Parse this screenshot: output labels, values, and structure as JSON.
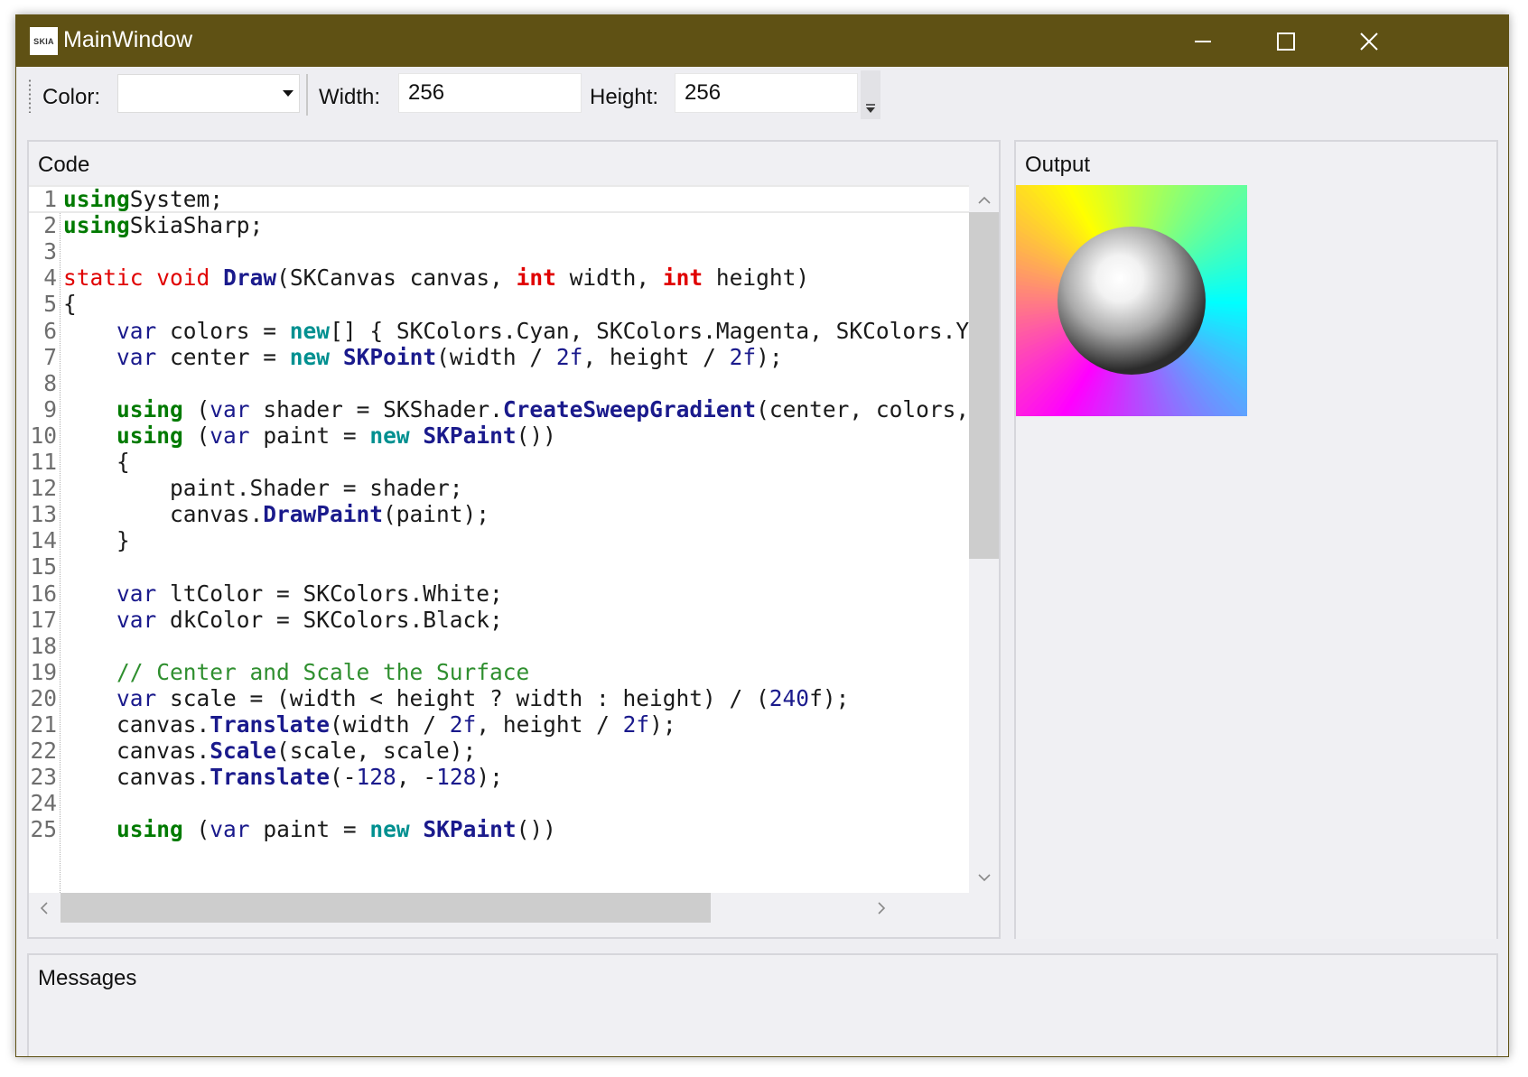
{
  "window": {
    "title": "MainWindow",
    "icon_text": "SKIA",
    "colors": {
      "titlebar": "#5f5114",
      "accent_text": "#ffffff"
    },
    "controls": [
      "minimize-icon",
      "maximize-icon",
      "close-icon"
    ]
  },
  "toolbar": {
    "color_label": "Color:",
    "color_value": "",
    "width_label": "Width:",
    "width_value": "256",
    "height_label": "Height:",
    "height_value": "256"
  },
  "code_panel": {
    "header": "Code",
    "lines": [
      {
        "n": "1",
        "tokens": [
          [
            "k-using",
            "using"
          ],
          [
            "",
            "System;"
          ]
        ]
      },
      {
        "n": "2",
        "tokens": [
          [
            "k-using",
            "using"
          ],
          [
            "",
            "SkiaSharp;"
          ]
        ]
      },
      {
        "n": "3",
        "tokens": []
      },
      {
        "n": "4",
        "tokens": [
          [
            "k-red",
            "static"
          ],
          [
            "",
            " "
          ],
          [
            "k-red",
            "void"
          ],
          [
            "",
            " "
          ],
          [
            "k-method",
            "Draw"
          ],
          [
            "",
            "(SKCanvas canvas, "
          ],
          [
            "k-red-bold",
            "int"
          ],
          [
            "",
            " width, "
          ],
          [
            "k-red-bold",
            "int"
          ],
          [
            "",
            " height)"
          ]
        ]
      },
      {
        "n": "5",
        "tokens": [
          [
            "",
            "{"
          ]
        ]
      },
      {
        "n": "6",
        "tokens": [
          [
            "",
            "    "
          ],
          [
            "k-var",
            "var"
          ],
          [
            "",
            " colors = "
          ],
          [
            "k-new",
            "new"
          ],
          [
            "",
            "[] { SKColors.Cyan, SKColors.Magenta, SKColors.Y"
          ]
        ]
      },
      {
        "n": "7",
        "tokens": [
          [
            "",
            "    "
          ],
          [
            "k-var",
            "var"
          ],
          [
            "",
            " center = "
          ],
          [
            "k-new",
            "new"
          ],
          [
            "",
            " "
          ],
          [
            "k-method",
            "SKPoint"
          ],
          [
            "",
            "(width / "
          ],
          [
            "k-num",
            "2f"
          ],
          [
            "",
            ", height / "
          ],
          [
            "k-num",
            "2f"
          ],
          [
            "",
            ");"
          ]
        ]
      },
      {
        "n": "8",
        "tokens": []
      },
      {
        "n": "9",
        "tokens": [
          [
            "",
            "    "
          ],
          [
            "k-using",
            "using"
          ],
          [
            "",
            " ("
          ],
          [
            "k-var",
            "var"
          ],
          [
            "",
            " shader = SKShader."
          ],
          [
            "k-method",
            "CreateSweepGradient"
          ],
          [
            "",
            "(center, colors,"
          ]
        ]
      },
      {
        "n": "10",
        "tokens": [
          [
            "",
            "    "
          ],
          [
            "k-using",
            "using"
          ],
          [
            "",
            " ("
          ],
          [
            "k-var",
            "var"
          ],
          [
            "",
            " paint = "
          ],
          [
            "k-new",
            "new"
          ],
          [
            "",
            " "
          ],
          [
            "k-method",
            "SKPaint"
          ],
          [
            "",
            "())"
          ]
        ]
      },
      {
        "n": "11",
        "tokens": [
          [
            "",
            "    {"
          ]
        ]
      },
      {
        "n": "12",
        "tokens": [
          [
            "",
            "        paint.Shader = shader;"
          ]
        ]
      },
      {
        "n": "13",
        "tokens": [
          [
            "",
            "        canvas."
          ],
          [
            "k-method",
            "DrawPaint"
          ],
          [
            "",
            "(paint);"
          ]
        ]
      },
      {
        "n": "14",
        "tokens": [
          [
            "",
            "    }"
          ]
        ]
      },
      {
        "n": "15",
        "tokens": []
      },
      {
        "n": "16",
        "tokens": [
          [
            "",
            "    "
          ],
          [
            "k-var",
            "var"
          ],
          [
            "",
            " ltColor = SKColors.White;"
          ]
        ]
      },
      {
        "n": "17",
        "tokens": [
          [
            "",
            "    "
          ],
          [
            "k-var",
            "var"
          ],
          [
            "",
            " dkColor = SKColors.Black;"
          ]
        ]
      },
      {
        "n": "18",
        "tokens": []
      },
      {
        "n": "19",
        "tokens": [
          [
            "",
            "    "
          ],
          [
            "k-comment",
            "// Center and Scale the Surface"
          ]
        ]
      },
      {
        "n": "20",
        "tokens": [
          [
            "",
            "    "
          ],
          [
            "k-var",
            "var"
          ],
          [
            "",
            " scale = (width < height ? width : height) / ("
          ],
          [
            "k-num",
            "240"
          ],
          [
            "",
            "f);"
          ]
        ]
      },
      {
        "n": "21",
        "tokens": [
          [
            "",
            "    canvas."
          ],
          [
            "k-method",
            "Translate"
          ],
          [
            "",
            "(width / "
          ],
          [
            "k-num",
            "2f"
          ],
          [
            "",
            ", height / "
          ],
          [
            "k-num",
            "2f"
          ],
          [
            "",
            ");"
          ]
        ]
      },
      {
        "n": "22",
        "tokens": [
          [
            "",
            "    canvas."
          ],
          [
            "k-method",
            "Scale"
          ],
          [
            "",
            "(scale, scale);"
          ]
        ]
      },
      {
        "n": "23",
        "tokens": [
          [
            "",
            "    canvas."
          ],
          [
            "k-method",
            "Translate"
          ],
          [
            "",
            "(-"
          ],
          [
            "k-num",
            "128"
          ],
          [
            "",
            ", -"
          ],
          [
            "k-num",
            "128"
          ],
          [
            "",
            ");"
          ]
        ]
      },
      {
        "n": "24",
        "tokens": []
      },
      {
        "n": "25",
        "tokens": [
          [
            "",
            "    "
          ],
          [
            "k-using",
            "using"
          ],
          [
            "",
            " ("
          ],
          [
            "k-var",
            "var"
          ],
          [
            "",
            " paint = "
          ],
          [
            "k-new",
            "new"
          ],
          [
            "",
            " "
          ],
          [
            "k-method",
            "SKPaint"
          ],
          [
            "",
            "())"
          ]
        ]
      }
    ]
  },
  "output_panel": {
    "header": "Output",
    "image_icon": "sphere-on-sweep-gradient"
  },
  "messages_panel": {
    "header": "Messages",
    "text": ""
  }
}
